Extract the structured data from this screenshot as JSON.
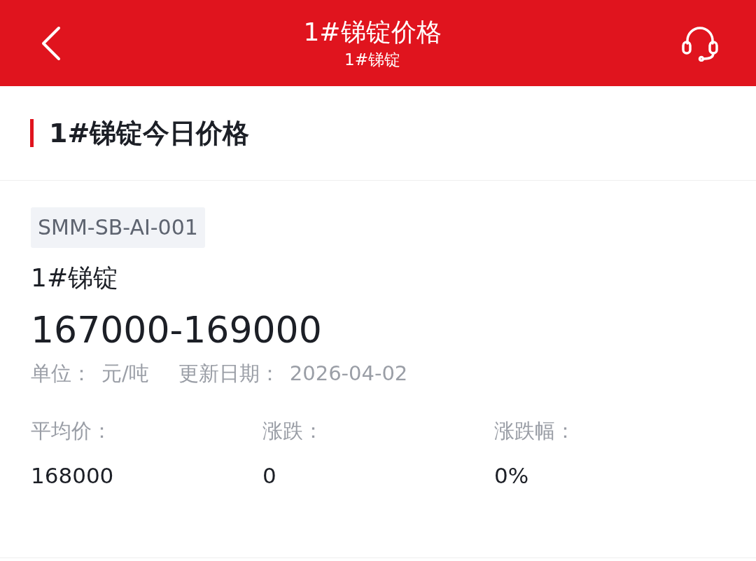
{
  "header": {
    "title": "1#锑锭价格",
    "subtitle": "1#锑锭"
  },
  "section": {
    "title": "1#锑锭今日价格"
  },
  "item": {
    "code": "SMM-SB-AI-001",
    "name": "1#锑锭",
    "price_range": "167000-169000",
    "unit_label": "单位：",
    "unit": "元/吨",
    "date_label": "更新日期：",
    "date": "2026-04-02"
  },
  "stats": [
    {
      "label": "平均价：",
      "value": "168000"
    },
    {
      "label": "涨跌：",
      "value": "0"
    },
    {
      "label": "涨跌幅：",
      "value": "0%"
    }
  ]
}
